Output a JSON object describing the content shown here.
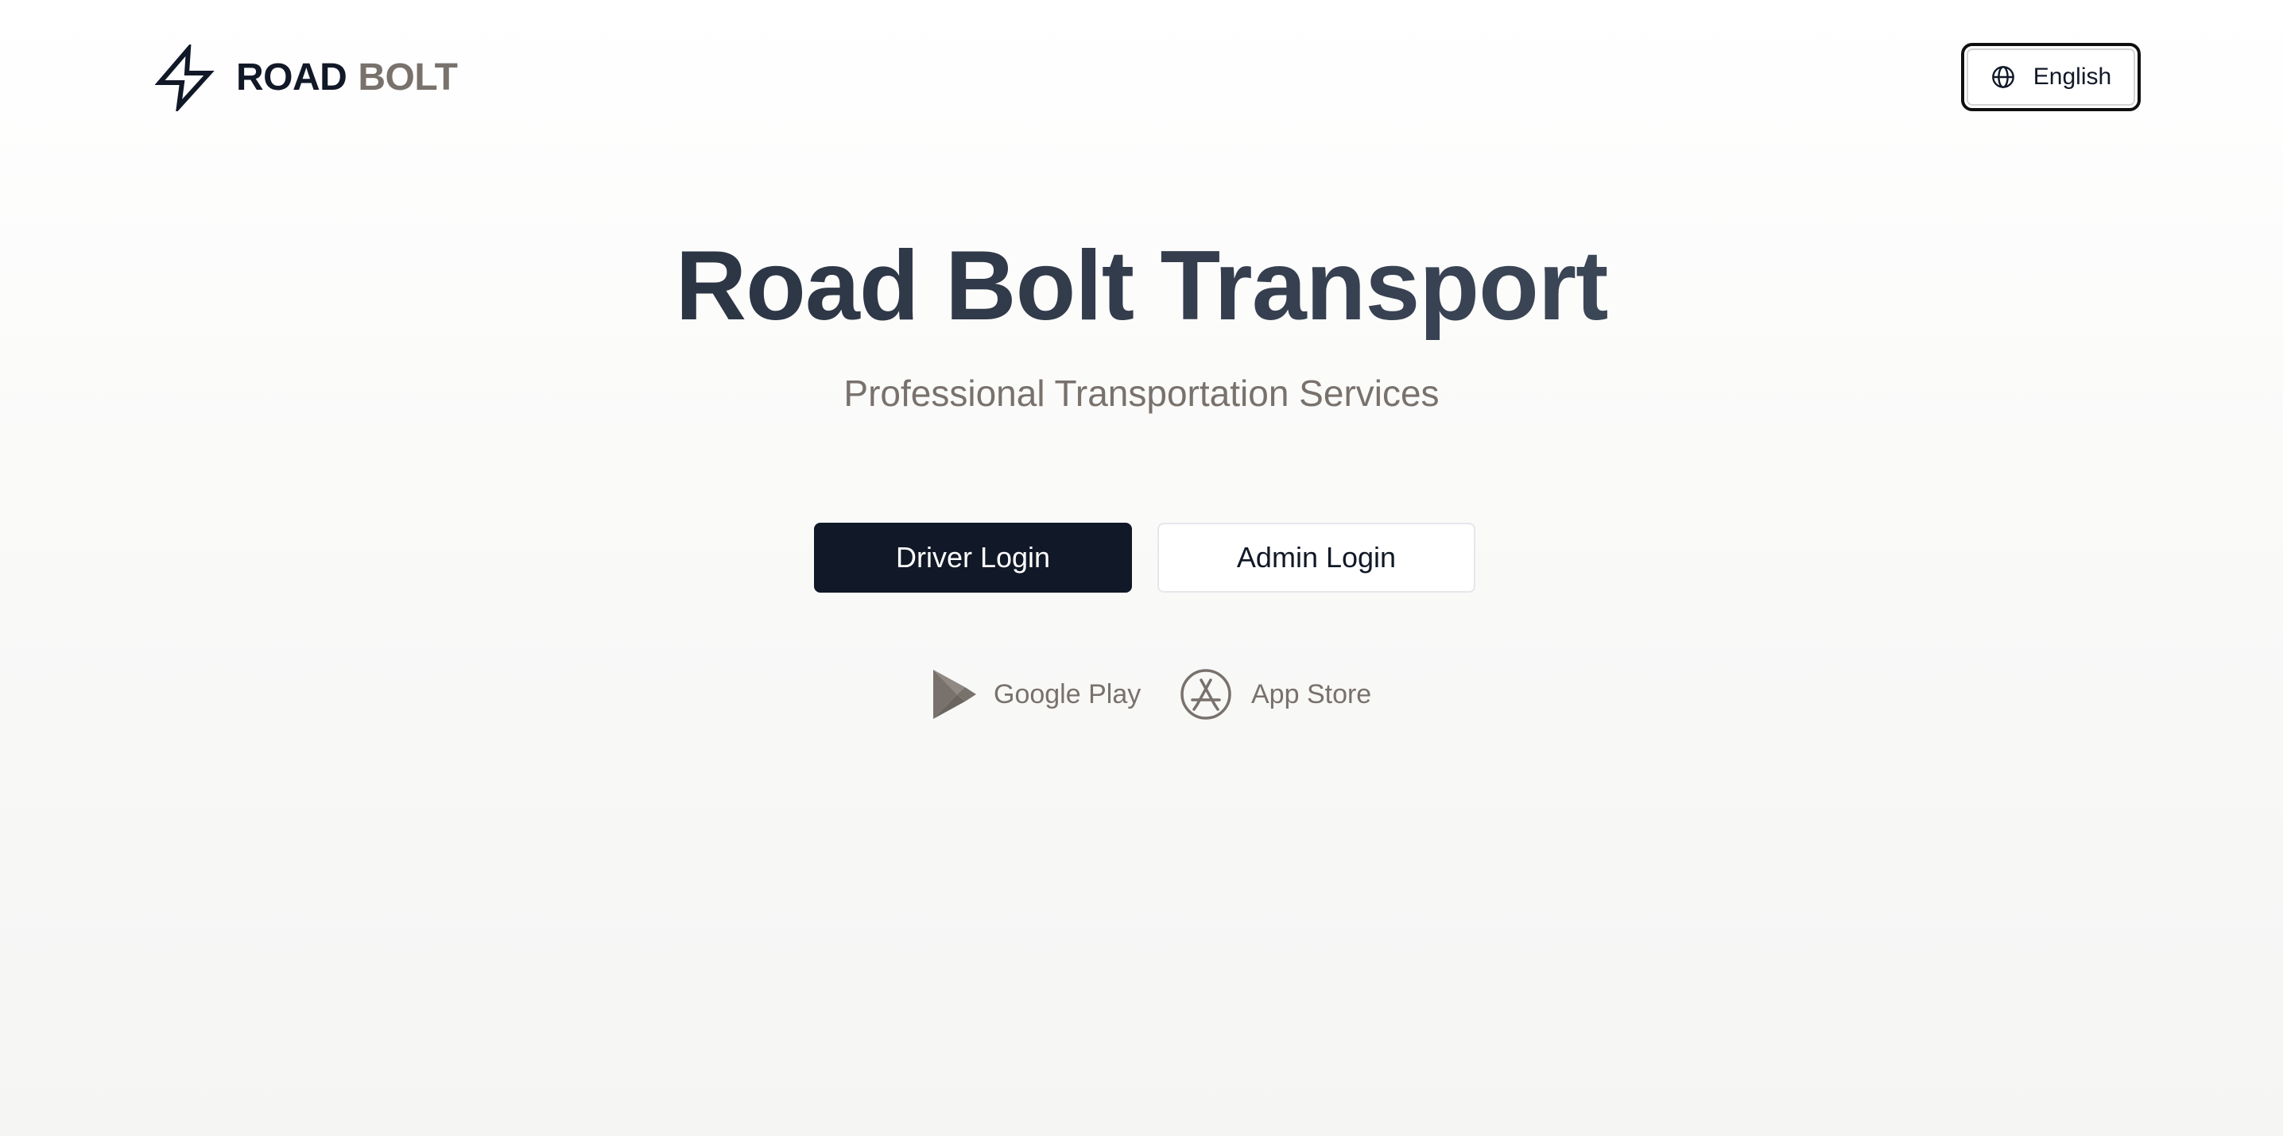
{
  "brand": {
    "name_part1": "ROAD",
    "name_part2": "BOLT",
    "icon": "lightning-bolt-icon"
  },
  "header": {
    "language_label": "English",
    "language_icon": "globe-icon"
  },
  "hero": {
    "title": "Road Bolt Transport",
    "subtitle": "Professional Transportation Services"
  },
  "actions": {
    "driver_login_label": "Driver Login",
    "admin_login_label": "Admin Login"
  },
  "stores": {
    "google_play_label": "Google Play",
    "google_play_icon": "google-play-icon",
    "app_store_label": "App Store",
    "app_store_icon": "app-store-icon"
  },
  "colors": {
    "primary": "#111827",
    "muted": "#78716c",
    "background": "#fafaf9"
  }
}
